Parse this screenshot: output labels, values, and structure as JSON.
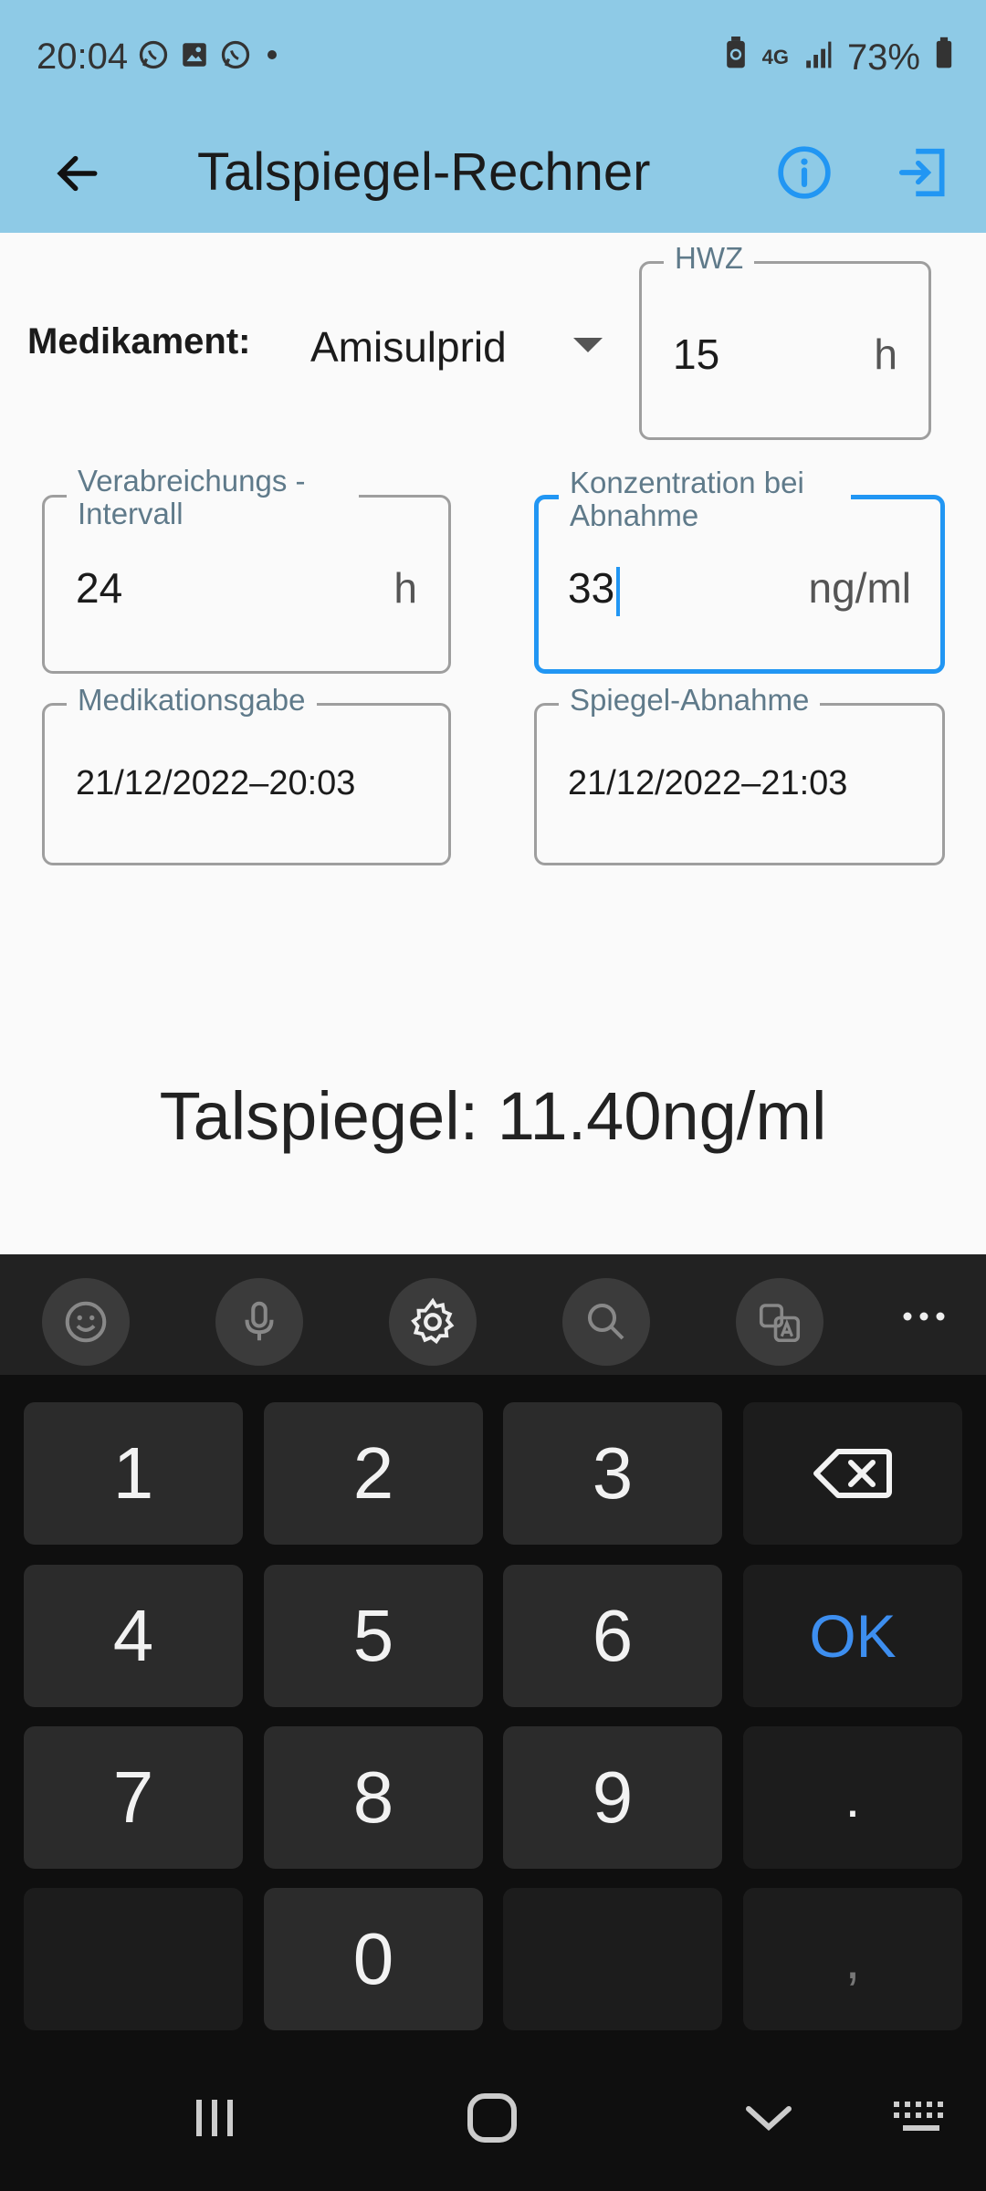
{
  "status_bar": {
    "time": "20:04",
    "left_icons": [
      "whatsapp-icon",
      "image-icon",
      "whatsapp-icon",
      "notification-dot-icon"
    ],
    "network": "4G",
    "battery": "73%"
  },
  "app_bar": {
    "title": "Talspiegel-Rechner",
    "accent": "#8ecae6",
    "icon_color": "#2196f3"
  },
  "form": {
    "med_label": "Medikament:",
    "med_value": "Amisulprid",
    "hwz": {
      "label": "HWZ",
      "value": "15",
      "suffix": "h"
    },
    "interval": {
      "label": "Verabreichungs - Intervall",
      "value": "24",
      "suffix": "h"
    },
    "concentration": {
      "label": "Konzentration bei Abnahme",
      "value": "33",
      "suffix": "ng/ml"
    },
    "medikationsgabe": {
      "label": "Medikationsgabe",
      "value": "21/12/2022–20:03"
    },
    "spiegel_abnahme": {
      "label": "Spiegel-Abnahme",
      "value": "21/12/2022–21:03"
    }
  },
  "result": {
    "text": "Talspiegel: 11.40ng/ml"
  },
  "keyboard": {
    "toolbar": [
      "emoji-icon",
      "microphone-icon",
      "settings-icon",
      "search-icon",
      "translate-icon",
      "more-icon"
    ],
    "keys": {
      "k1": "1",
      "k2": "2",
      "k3": "3",
      "k4": "4",
      "k5": "5",
      "k6": "6",
      "ok": "OK",
      "k7": "7",
      "k8": "8",
      "k9": "9",
      "dot": ".",
      "k0": "0",
      "comma": ","
    }
  },
  "nav_bar": [
    "recent-apps-icon",
    "home-icon",
    "hide-keyboard-icon",
    "keyboard-switch-icon"
  ]
}
